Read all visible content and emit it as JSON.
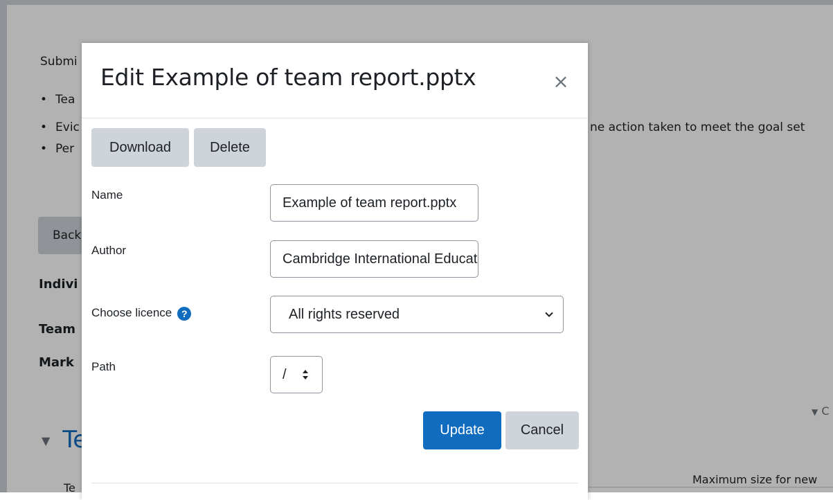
{
  "background": {
    "submission_label": "Submi",
    "bullets": [
      "Tea",
      "Evic",
      "Per"
    ],
    "right_text": "ne action taken to meet the goal set",
    "back_button": "Back",
    "individual_label": "Indivi",
    "team_label": "Team",
    "mark_label": "Mark",
    "section_heading": "Te",
    "section_body": "Te",
    "collapse_link": "C",
    "max_size_text": "Maximum size for new"
  },
  "modal": {
    "title": "Edit Example of team report.pptx",
    "close_symbol": "×",
    "download_label": "Download",
    "delete_label": "Delete",
    "name_label": "Name",
    "name_value": "Example of team report.pptx",
    "author_label": "Author",
    "author_value": "Cambridge International Education",
    "licence_label": "Choose licence",
    "licence_help_symbol": "?",
    "licence_selected": "All rights reserved",
    "path_label": "Path",
    "path_value": "/",
    "update_label": "Update",
    "cancel_label": "Cancel"
  },
  "colors": {
    "primary": "#0f6cbf",
    "secondary": "#ced4da",
    "backdrop": "rgba(0,0,0,0.30)"
  }
}
